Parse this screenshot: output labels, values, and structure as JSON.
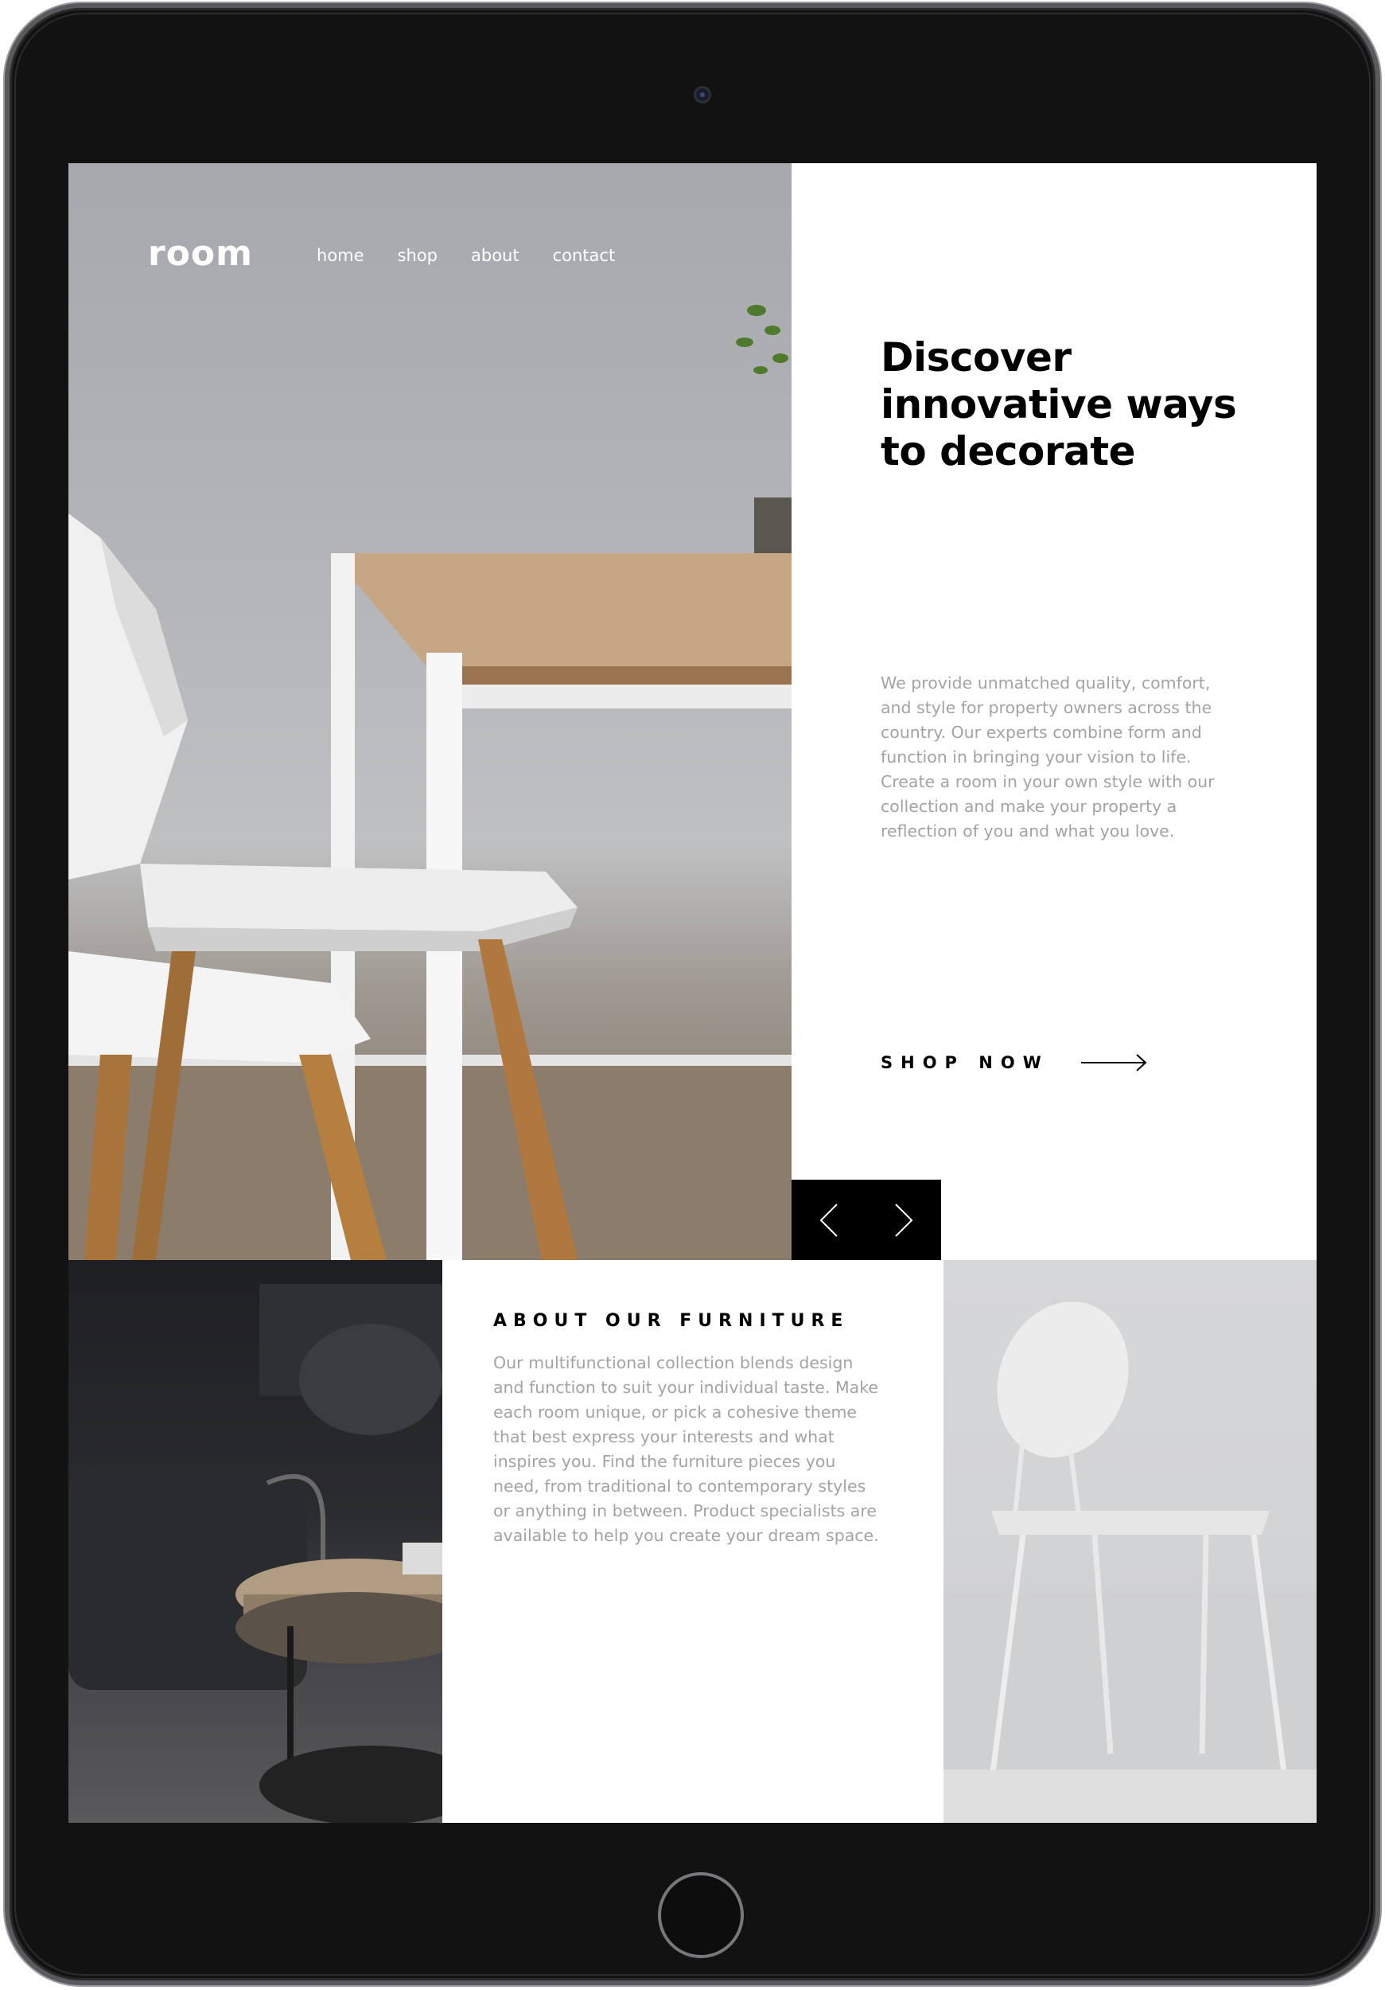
{
  "nav": {
    "logo": "room",
    "links": [
      "home",
      "shop",
      "about",
      "contact"
    ]
  },
  "hero": {
    "title": "Discover innovative ways to decorate",
    "description": "We provide unmatched quality, comfort, and style for property owners across the country. Our experts combine form and function in bringing your vision to life. Create a room in your own style with our collection and make your property a reflection of you and what you love.",
    "cta_label": "SHOP NOW",
    "cta_icon": "arrow-right-icon"
  },
  "slider": {
    "prev_icon": "chevron-left-icon",
    "next_icon": "chevron-right-icon"
  },
  "about": {
    "title": "ABOUT OUR FURNITURE",
    "text": "Our multifunctional collection blends design and function to suit your individual taste. Make each room unique, or pick a cohesive theme that best express your interests and what inspires you. Find the furniture pieces you need, from traditional to contemporary styles or anything in between. Product specialists are available to help you create your dream space."
  },
  "colors": {
    "accent": "#000000",
    "body_text": "#a3a3a3",
    "background": "#ffffff"
  }
}
